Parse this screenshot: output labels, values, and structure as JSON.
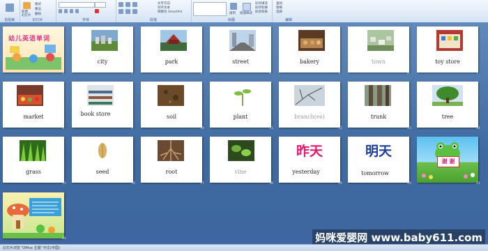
{
  "ribbon": {
    "groups": [
      "剪贴板",
      "幻灯片",
      "字体",
      "段落",
      "绘图",
      "编辑"
    ],
    "new_slide": "新建",
    "new_slide2": "幻灯片",
    "layout": "版式",
    "reset": "重设",
    "delete": "删除",
    "text_direction": "文字方向",
    "align_text": "对齐文本",
    "smartart": "转换为 SmartArt",
    "arrange": "排列",
    "quick_styles": "快速样式",
    "shape_fill": "形状填充",
    "shape_outline": "形状轮廓",
    "shape_effects": "形状效果",
    "find": "查找",
    "replace": "替换",
    "select": "选择"
  },
  "slides": [
    {
      "num": "1",
      "title": "幼儿英语单词"
    },
    {
      "num": "2",
      "word": "city"
    },
    {
      "num": "3",
      "word": "park"
    },
    {
      "num": "4",
      "word": "street"
    },
    {
      "num": "5",
      "word": "bakery"
    },
    {
      "num": "6",
      "word": "town"
    },
    {
      "num": "7",
      "word": "toy store"
    },
    {
      "num": "8",
      "word": "market"
    },
    {
      "num": "9",
      "word": "book store"
    },
    {
      "num": "10",
      "word": "soil"
    },
    {
      "num": "11",
      "word": "plant"
    },
    {
      "num": "12",
      "word": "branch(es)"
    },
    {
      "num": "13",
      "word": "trunk"
    },
    {
      "num": "14",
      "word": "tree"
    },
    {
      "num": "15",
      "word": "grass"
    },
    {
      "num": "16",
      "word": "seed"
    },
    {
      "num": "17",
      "word": "root"
    },
    {
      "num": "18",
      "word": "vine"
    },
    {
      "num": "19",
      "word": "yesterday",
      "cn": "昨天"
    },
    {
      "num": "20",
      "word": "tomorrow",
      "cn": "明天"
    },
    {
      "num": "21",
      "sign": "谢 谢"
    },
    {
      "num": "22"
    }
  ],
  "status": {
    "slide_view": "幻灯片浏览",
    "theme": "\"Office 主题\"",
    "lang": "中文(中国)"
  },
  "watermark": "妈咪爱婴网 www.baby611.com",
  "colors": {
    "cn_red": "#e8176e",
    "cn_blue": "#1f3e9c",
    "background": "#4a74a8"
  }
}
